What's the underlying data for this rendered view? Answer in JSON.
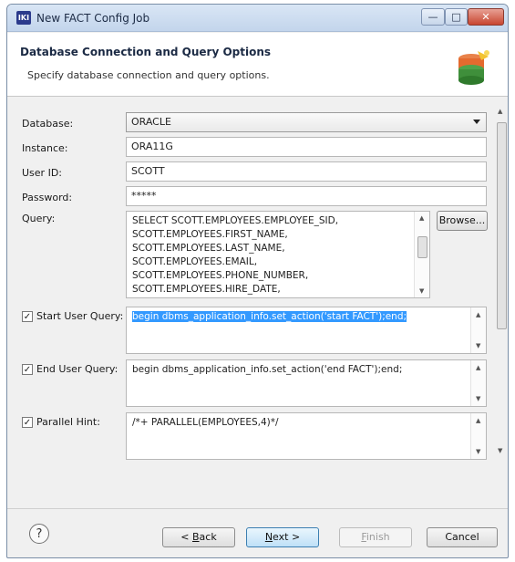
{
  "window": {
    "title": "New FACT Config Job",
    "app_icon_text": "IKI",
    "minimize": "—",
    "maximize": "□",
    "close": "✕"
  },
  "banner": {
    "title": "Database Connection and Query Options",
    "subtitle": "Specify database connection and query options."
  },
  "form": {
    "database": {
      "label": "Database:",
      "value": "ORACLE"
    },
    "instance": {
      "label": "Instance:",
      "value": "ORA11G"
    },
    "user_id": {
      "label": "User ID:",
      "value": "SCOTT"
    },
    "password": {
      "label": "Password:",
      "value": "*****"
    },
    "query": {
      "label": "Query:",
      "lines": [
        "SELECT SCOTT.EMPLOYEES.EMPLOYEE_SID,",
        "SCOTT.EMPLOYEES.FIRST_NAME,",
        "SCOTT.EMPLOYEES.LAST_NAME,",
        "SCOTT.EMPLOYEES.EMAIL,",
        "SCOTT.EMPLOYEES.PHONE_NUMBER,",
        "SCOTT.EMPLOYEES.HIRE_DATE,"
      ],
      "browse_label": "Browse..."
    },
    "start_user_query": {
      "label": "Start User Query:",
      "checked": true,
      "value": "begin dbms_application_info.set_action('start FACT');end;"
    },
    "end_user_query": {
      "label": "End User Query:",
      "checked": true,
      "value": "begin dbms_application_info.set_action('end FACT');end;"
    },
    "parallel_hint": {
      "label": "Parallel Hint:",
      "checked": true,
      "value": "/*+ PARALLEL(EMPLOYEES,4)*/"
    }
  },
  "footer": {
    "help": "?",
    "back": {
      "prefix": "< ",
      "mnemonic": "B",
      "rest": "ack"
    },
    "next": {
      "mnemonic": "N",
      "rest": "ext >"
    },
    "finish": {
      "mnemonic": "F",
      "rest": "inish"
    },
    "cancel": "Cancel"
  }
}
